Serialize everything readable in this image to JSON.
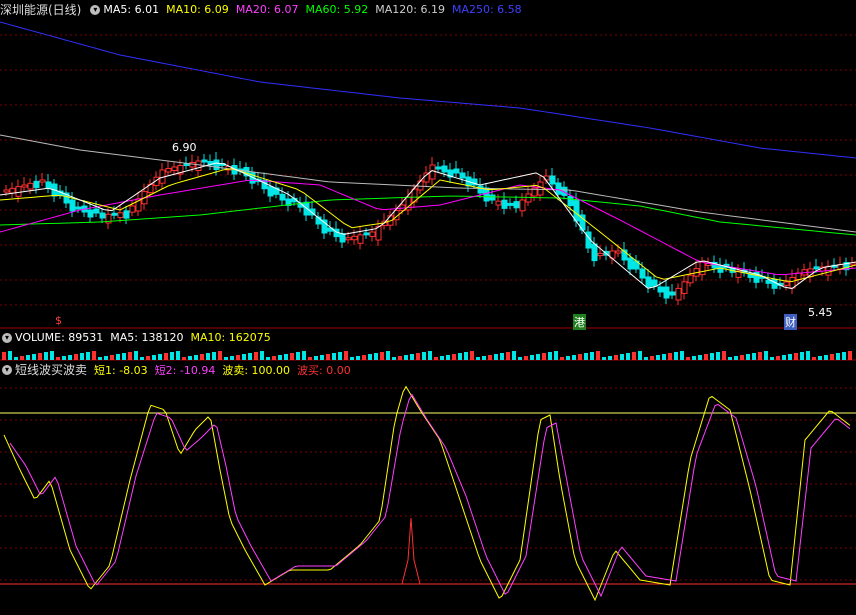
{
  "price_panel": {
    "title": "深圳能源(日线)",
    "ma5_label": "MA5: 6.01",
    "ma10_label": "MA10: 6.09",
    "ma20_label": "MA20: 6.07",
    "ma60_label": "MA60: 5.92",
    "ma120_label": "MA120: 6.19",
    "ma250_label": "MA250: 6.58",
    "high_label": "6.90",
    "low_label": "5.45",
    "marker_s": "$",
    "marker_gang": "港",
    "marker_cai": "财",
    "colors": {
      "ma5": "#ffffff",
      "ma10": "#ffff00",
      "ma20": "#ff00ff",
      "ma60": "#00ff00",
      "ma120": "#bbbbbb",
      "ma250": "#3030ff",
      "up": "#ff3030",
      "down": "#00e5e5"
    }
  },
  "volume_panel": {
    "volume_label": "VOLUME: 89531",
    "ma5_label": "MA5: 138120",
    "ma10_label": "MA10: 162075"
  },
  "indicator_panel": {
    "title": "短线波买波卖",
    "short1_label": "短1: -8.03",
    "short2_label": "短2: -10.94",
    "sell_label": "波卖: 100.00",
    "buy_label": "波买: 0.00"
  },
  "icons": {
    "collapse": "chevron-down-icon"
  }
}
